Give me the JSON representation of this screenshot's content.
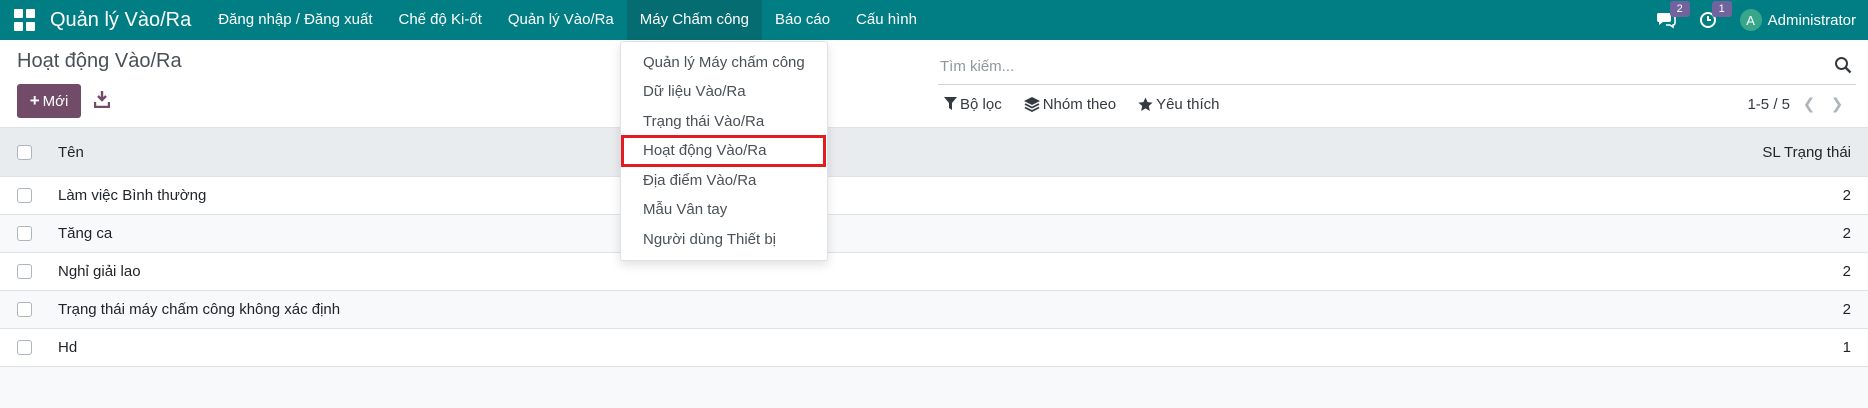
{
  "navbar": {
    "app_title": "Quản lý Vào/Ra",
    "menu": [
      {
        "label": "Đăng nhập / Đăng xuất"
      },
      {
        "label": "Chế độ Ki-ốt"
      },
      {
        "label": "Quản lý Vào/Ra"
      },
      {
        "label": "Máy Chấm công"
      },
      {
        "label": "Báo cáo"
      },
      {
        "label": "Cấu hình"
      }
    ],
    "active_menu": "Máy Chấm công",
    "messages_badge": "2",
    "activities_badge": "1",
    "user_initial": "A",
    "user_name": "Administrator",
    "bar_color": "#017e84"
  },
  "control_panel": {
    "title": "Hoạt động Vào/Ra",
    "new_button": "Mới",
    "search_placeholder": "Tìm kiếm...",
    "filters_label": "Bộ lọc",
    "group_by_label": "Nhóm theo",
    "favorites_label": "Yêu thích",
    "pager": "1-5 / 5",
    "accent_color": "#714b67"
  },
  "dropdown": {
    "items": [
      {
        "label": "Quản lý Máy chấm công"
      },
      {
        "label": "Dữ liệu Vào/Ra"
      },
      {
        "label": "Trạng thái Vào/Ra"
      },
      {
        "label": "Hoạt động Vào/Ra"
      },
      {
        "label": "Địa điểm Vào/Ra"
      },
      {
        "label": "Mẫu Vân tay"
      },
      {
        "label": "Người dùng Thiết bị"
      }
    ],
    "highlighted": "Hoạt động Vào/Ra",
    "highlight_color": "#e11d22"
  },
  "table": {
    "columns": {
      "name": "Tên",
      "count": "SL Trạng thái"
    },
    "rows": [
      {
        "name": "Làm việc Bình thường",
        "count": "2"
      },
      {
        "name": "Tăng ca",
        "count": "2"
      },
      {
        "name": "Nghỉ giải lao",
        "count": "2"
      },
      {
        "name": "Trạng thái máy chấm công không xác định",
        "count": "2"
      },
      {
        "name": "Hd",
        "count": "1"
      }
    ]
  }
}
